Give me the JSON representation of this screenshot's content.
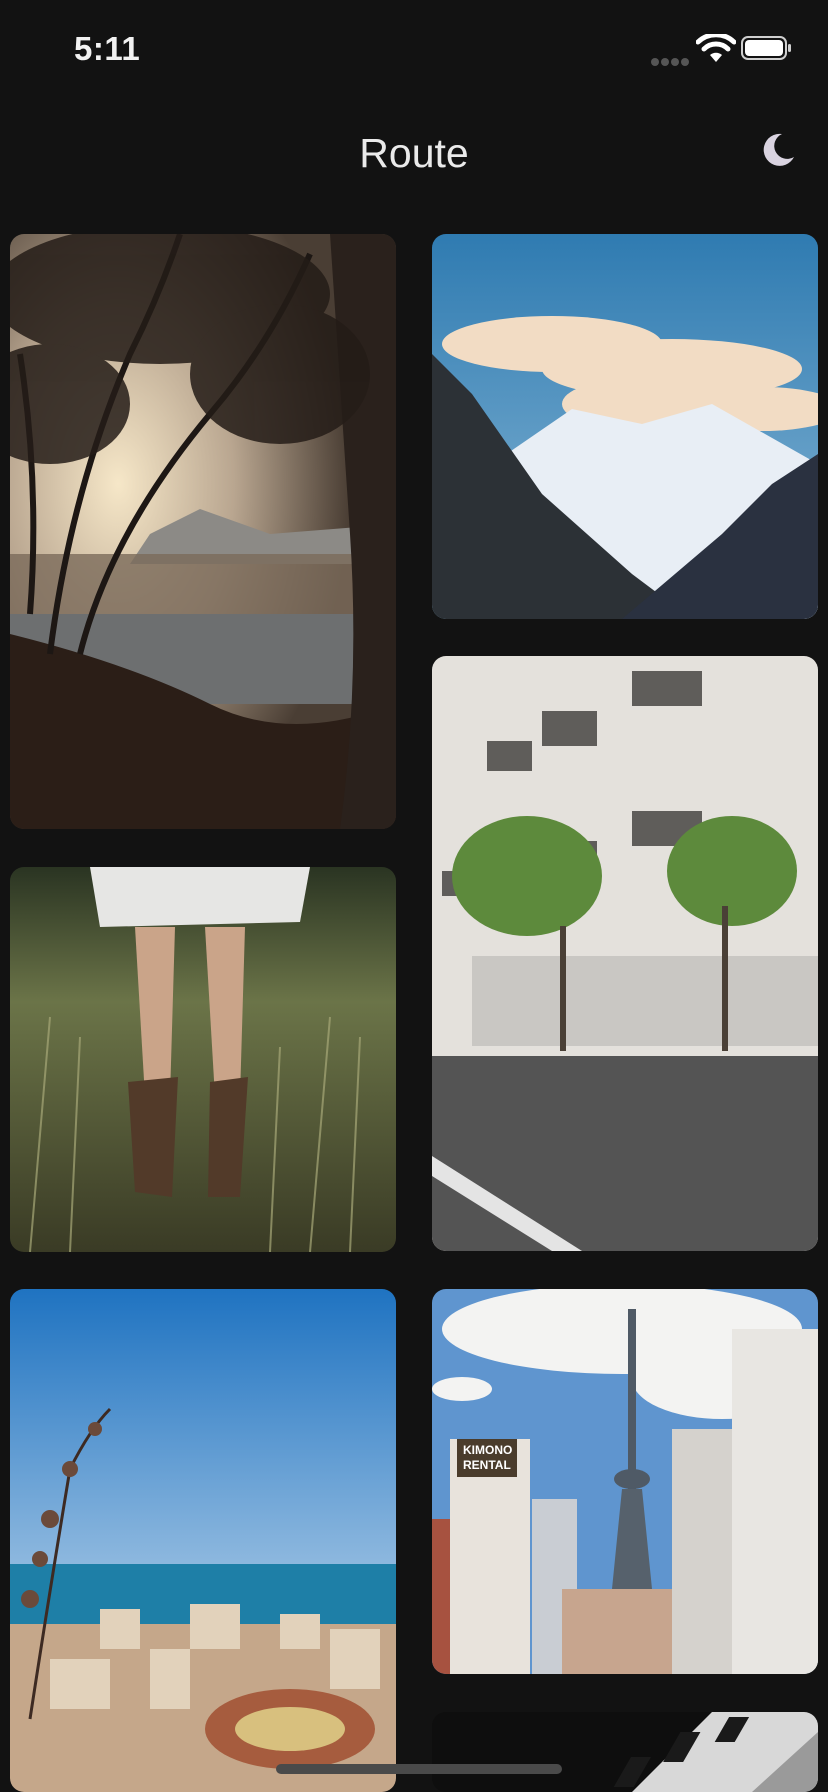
{
  "status_bar": {
    "time": "5:11",
    "icons": [
      "cellular-signal-icon",
      "wifi-icon",
      "battery-icon"
    ]
  },
  "header": {
    "title": "Route",
    "toggle_icon": "moon-icon"
  },
  "photos": [
    {
      "name": "forest-lake-sunrise",
      "column": "left"
    },
    {
      "name": "snow-mountain-clouds",
      "column": "right"
    },
    {
      "name": "white-building-trees",
      "column": "right"
    },
    {
      "name": "legs-in-grass-boots",
      "column": "left"
    },
    {
      "name": "coastal-city-bullring",
      "column": "left"
    },
    {
      "name": "tokyo-skytree-street",
      "column": "right"
    },
    {
      "name": "black-white-architecture",
      "column": "right"
    }
  ],
  "signs": {
    "kimono_line1": "KIMONO",
    "kimono_line2": "RENTAL"
  },
  "colors": {
    "background": "#121212",
    "text": "#f2f2f2",
    "moon": "#d9d3e0"
  }
}
